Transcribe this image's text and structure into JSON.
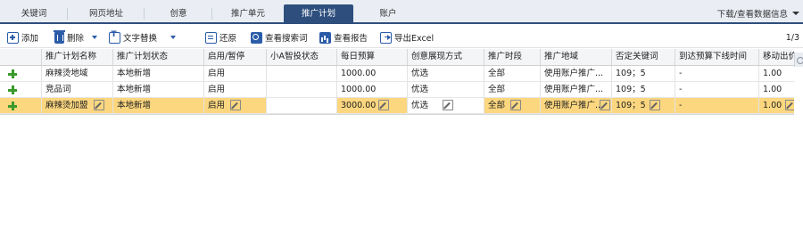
{
  "tabs": [
    {
      "label": "关键词"
    },
    {
      "label": "网页地址"
    },
    {
      "label": "创意"
    },
    {
      "label": "推广单元"
    },
    {
      "label": "推广计划"
    },
    {
      "label": "账户"
    }
  ],
  "download_link": "下载/查看数据信息",
  "toolbar": {
    "add": "添加",
    "delete": "删除",
    "text_replace": "文字替换",
    "restore": "还原",
    "search_terms": "查看搜索词",
    "report": "查看报告",
    "export": "导出Excel"
  },
  "pager": "1/3",
  "table": {
    "headers": [
      "推广计划名称",
      "推广计划状态",
      "启用/暂停",
      "小A智投状态",
      "每日预算",
      "创意展现方式",
      "推广时段",
      "推广地域",
      "否定关键词",
      "到达预算下线时间",
      "移动出价"
    ],
    "rows": [
      [
        "麻辣烫地域",
        "本地新增",
        "启用",
        "",
        "1000.00",
        "优选",
        "全部",
        "使用账户推广...",
        "109；5",
        "-",
        "1.00"
      ],
      [
        "竞品词",
        "本地新增",
        "启用",
        "",
        "1000.00",
        "优选",
        "全部",
        "使用账户推广...",
        "109；5",
        "-",
        "1.00"
      ],
      [
        "麻辣烫加盟",
        "本地新增",
        "启用",
        "",
        "3000.00",
        "优选",
        "全部",
        "使用账户推广...",
        "109；5",
        "-",
        "1.00"
      ]
    ]
  },
  "colors": {
    "accent": "#2e4f7e",
    "selected_row": "#fcd77f",
    "icon_blue": "#2b5ca8",
    "plus_green": "#3b9a2c"
  }
}
